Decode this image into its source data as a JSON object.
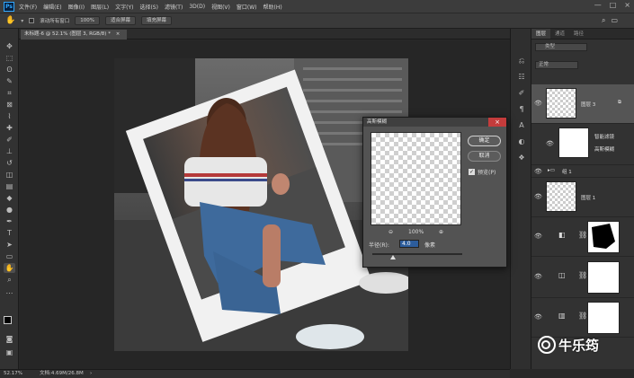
{
  "app": {
    "logo_text": "Ps"
  },
  "menu": [
    "文件(F)",
    "编辑(E)",
    "图像(I)",
    "图层(L)",
    "文字(Y)",
    "选择(S)",
    "滤镜(T)",
    "3D(D)",
    "视图(V)",
    "窗口(W)",
    "帮助(H)"
  ],
  "window_controls": [
    "—",
    "□",
    "×"
  ],
  "options": {
    "scroll_all_label": "滚动所有窗口",
    "zoom": "100%",
    "fit_screen": "适合屏幕",
    "fill_screen": "填充屏幕"
  },
  "document": {
    "tab_title": "未标题-6 @ 52.1% (图层 3, RGB/8) *",
    "zoom_status": "52.17%",
    "doc_info": "文档:4.69M/26.8M"
  },
  "layers_panel": {
    "tabs": [
      "图层",
      "通道",
      "路径"
    ],
    "filter_placeholder": "类型",
    "blend_mode": "正常",
    "layers": [
      {
        "name": "图层 3",
        "selected": true
      },
      {
        "name": "智能滤镜"
      },
      {
        "name": "高斯模糊"
      },
      {
        "name": "组 1"
      },
      {
        "name": "图层 1"
      }
    ]
  },
  "dialog": {
    "title": "高斯模糊",
    "ok_label": "确定",
    "cancel_label": "取消",
    "preview_label": "预览(P)",
    "preview_checked": true,
    "zoom_value": "100%",
    "radius_label": "半径(R):",
    "radius_value": "4.0",
    "radius_unit": "像素"
  },
  "watermark": {
    "text": "牛乐筠"
  }
}
